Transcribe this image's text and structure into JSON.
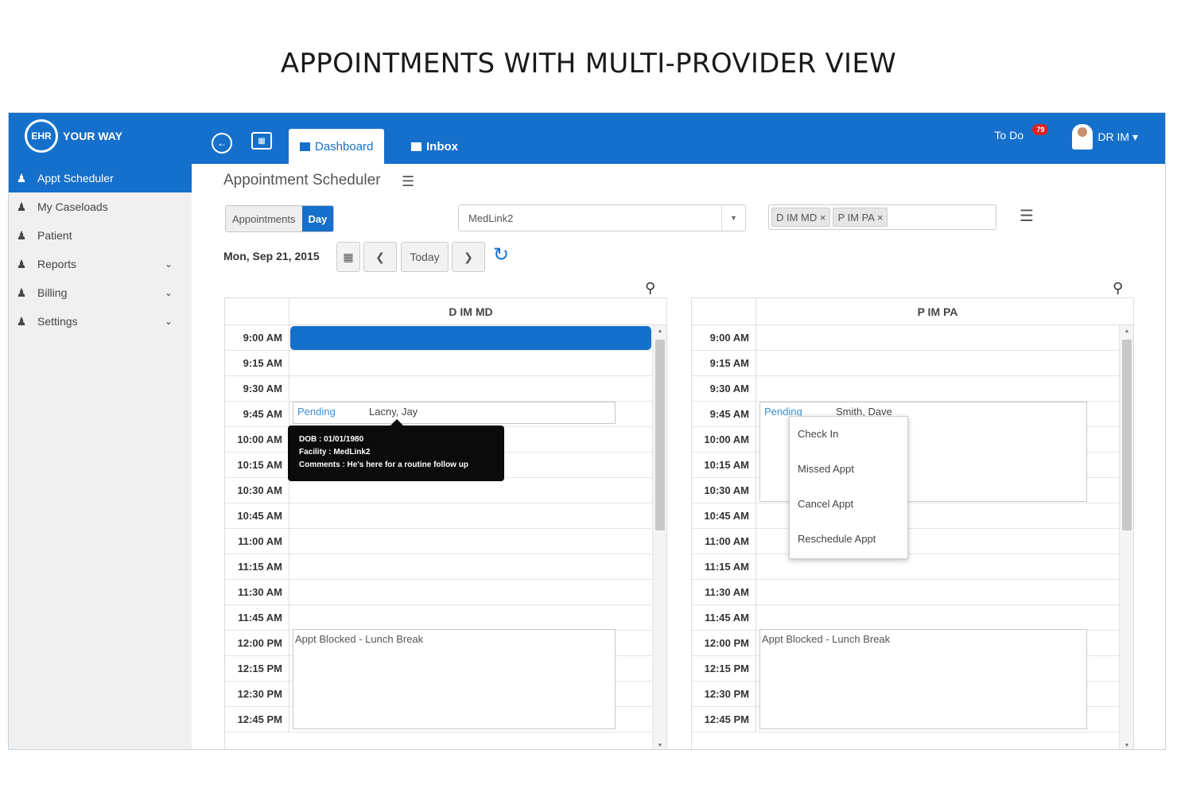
{
  "page_title": "APPOINTMENTS WITH MULTI-PROVIDER VIEW",
  "brand": {
    "logo_mark": "EHR",
    "logo_text": "YOUR WAY",
    "color": "#1570cc"
  },
  "header": {
    "tabs": [
      {
        "label": "Dashboard"
      },
      {
        "label": "Inbox"
      }
    ],
    "todo_label": "To Do",
    "todo_count": "79",
    "user_name": "DR IM ▾"
  },
  "sidebar": {
    "items": [
      {
        "label": "Appt Scheduler",
        "icon": "users-icon",
        "active": true
      },
      {
        "label": "My Caseloads",
        "icon": "users-icon"
      },
      {
        "label": "Patient",
        "icon": "users-icon"
      },
      {
        "label": "Reports",
        "icon": "users-icon"
      },
      {
        "label": "Billing",
        "icon": "users-icon"
      },
      {
        "label": "Settings",
        "icon": "users-icon"
      }
    ],
    "chevron": "⌄"
  },
  "main": {
    "title": "Appointment Scheduler",
    "view_toggle": {
      "appointments_label": "Appointments",
      "day_label": "Day"
    },
    "facility": "MedLink2",
    "provider_chips": [
      "D IM MD ×",
      "P IM PA ×"
    ],
    "date": "Mon, Sep 21, 2015",
    "today_label": "Today"
  },
  "calendars": [
    {
      "provider": "D IM MD",
      "times": [
        "9:00 AM",
        "9:15 AM",
        "9:30 AM",
        "9:45 AM",
        "10:00 AM",
        "10:15 AM",
        "10:30 AM",
        "10:45 AM",
        "11:00 AM",
        "11:15 AM",
        "11:30 AM",
        "11:45 AM",
        "12:00 PM",
        "12:15 PM",
        "12:30 PM",
        "12:45 PM"
      ],
      "appointment": {
        "status": "Pending",
        "patient": "Lacny, Jay"
      },
      "block": "Appt Blocked - Lunch Break",
      "tooltip": {
        "dob": "DOB : 01/01/1980",
        "facility": "Facility : MedLink2",
        "comments": "Comments : He's here for a routine follow up"
      }
    },
    {
      "provider": "P IM PA",
      "times": [
        "9:00 AM",
        "9:15 AM",
        "9:30 AM",
        "9:45 AM",
        "10:00 AM",
        "10:15 AM",
        "10:30 AM",
        "10:45 AM",
        "11:00 AM",
        "11:15 AM",
        "11:30 AM",
        "11:45 AM",
        "12:00 PM",
        "12:15 PM",
        "12:30 PM",
        "12:45 PM"
      ],
      "appointment": {
        "status": "Pending",
        "patient": "Smith, Dave"
      },
      "block": "Appt Blocked - Lunch Break",
      "context_menu": [
        "Check In",
        "Missed Appt",
        "Cancel Appt",
        "Reschedule Appt"
      ]
    }
  ]
}
